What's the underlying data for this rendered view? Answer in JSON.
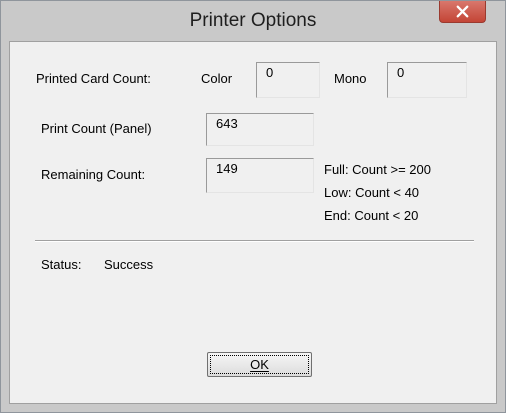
{
  "window": {
    "title": "Printer Options"
  },
  "printed_card_count": {
    "label": "Printed Card Count:",
    "color_label": "Color",
    "color_value": "0",
    "mono_label": "Mono",
    "mono_value": "0"
  },
  "print_count_panel": {
    "label": "Print Count (Panel)",
    "value": "643"
  },
  "remaining_count": {
    "label": "Remaining Count:",
    "value": "149",
    "legend": [
      "Full: Count >= 200",
      "Low: Count < 40",
      "End: Count < 20"
    ]
  },
  "status": {
    "label": "Status:",
    "value": "Success"
  },
  "buttons": {
    "ok_label": "OK"
  },
  "icons": {
    "close": "close-icon"
  },
  "colors": {
    "close_button": "#c44536",
    "dialog_background": "#f0f0f0",
    "title_bar": "#c9c9c9"
  }
}
